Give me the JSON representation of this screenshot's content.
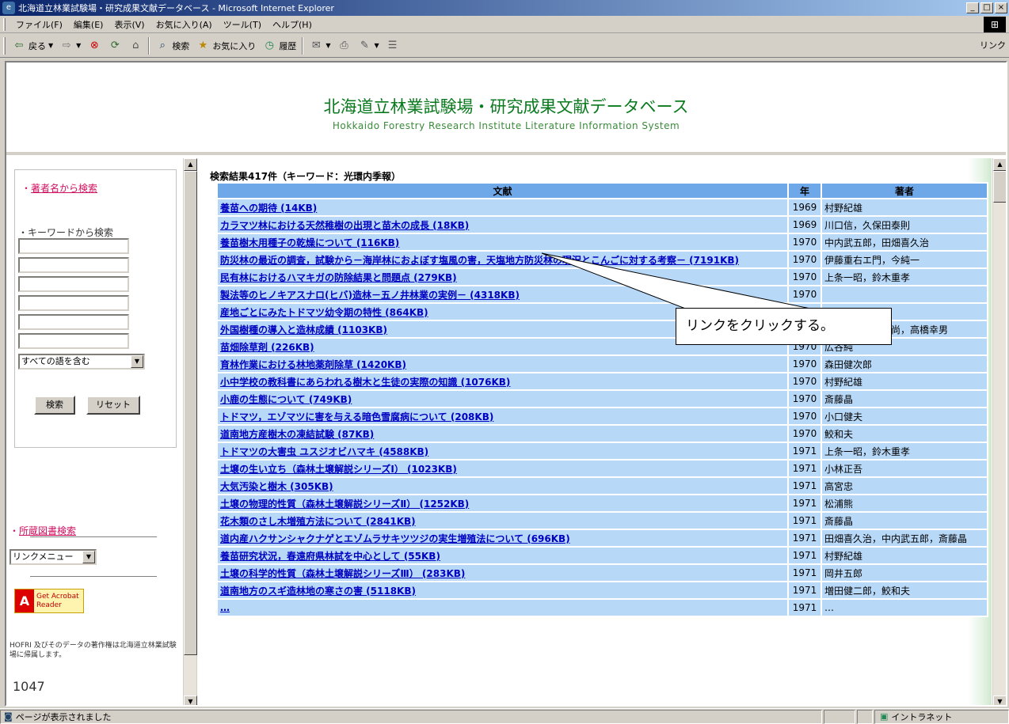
{
  "window": {
    "title": "北海道立林業試験場・研究成果文献データベース - Microsoft Internet Explorer",
    "buttons": [
      "_",
      "□",
      "×"
    ]
  },
  "menubar": {
    "items": [
      "ファイル(F)",
      "編集(E)",
      "表示(V)",
      "お気に入り(A)",
      "ツール(T)",
      "ヘルプ(H)"
    ]
  },
  "toolbar": {
    "back": "戻る",
    "search": "検索",
    "favorites": "お気に入り",
    "history": "履歴",
    "links": "リンク"
  },
  "header": {
    "title_jp": "北海道立林業試験場・研究成果文献データベース",
    "title_en": "Hokkaido Forestry Research Institute Literature Information System"
  },
  "sidebar": {
    "author_search": "著者名から検索",
    "keyword_label": "キーワードから検索",
    "match_mode": "すべての語を含む",
    "search_button": "検索",
    "reset_button": "リセット",
    "library_search": "所蔵図書検索",
    "link_menu": "リンクメニュー",
    "acrobat_line1": "Get Acrobat",
    "acrobat_line2": "Reader",
    "acrobat_logo": "A",
    "copyright": "HOFRI 及びそのデータの著作権は北海道立林業試験場に帰属します。",
    "counter": "1047"
  },
  "results": {
    "summary": "検索結果417件（キーワード：光環内季報）",
    "columns": [
      "文献",
      "年",
      "著者"
    ],
    "rows": [
      {
        "title": "養苗への期待 (14KB)",
        "year": "1969",
        "author": "村野紀雄"
      },
      {
        "title": "カラマツ林における天然稚樹の出現と苗木の成長 (18KB)",
        "year": "1969",
        "author": "川口信，久保田泰則"
      },
      {
        "title": "養苗樹木用種子の乾燥について (116KB)",
        "year": "1970",
        "author": "中内武五郎，田畑喜久治"
      },
      {
        "title": "防災林の最近の調査，試験から－海岸林におよぼす塩風の害，天塩地方防災林の現況とこんごに対する考察－ (7191KB)",
        "year": "1970",
        "author": "伊藤重右エ門，今純一"
      },
      {
        "title": "民有林におけるハマキガの防除結果と問題点 (279KB)",
        "year": "1970",
        "author": "上条一昭，鈴木重孝"
      },
      {
        "title": "製法等のヒノキアスナロ(ヒバ)造林－五ノ井林業の実例－ (4318KB)",
        "year": "1970",
        "author": ""
      },
      {
        "title": "産地ごとにみたトドマツ幼令期の特性 (864KB)",
        "year": "1970",
        "author": ""
      },
      {
        "title": "外国樹種の導入と造林成績 (1103KB)",
        "year": "1970",
        "author": "…弁重雄，花房尚，高橋幸男"
      },
      {
        "title": "苗畑除草剤 (226KB)",
        "year": "1970",
        "author": "広谷純"
      },
      {
        "title": "育林作業における林地薬剤除草 (1420KB)",
        "year": "1970",
        "author": "森田健次郎"
      },
      {
        "title": "小中学校の教科書にあらわれる樹木と生徒の実際の知識 (1076KB)",
        "year": "1970",
        "author": "村野紀雄"
      },
      {
        "title": "小鹿の生態について (749KB)",
        "year": "1970",
        "author": "斎藤晶"
      },
      {
        "title": "トドマツ，エゾマツに害を与える暗色雪腐病について (208KB)",
        "year": "1970",
        "author": "小口健夫"
      },
      {
        "title": "道南地方産樹木の凍結試験 (87KB)",
        "year": "1970",
        "author": "鮫和夫"
      },
      {
        "title": "トドマツの大害虫 ユスジオビハマキ (4588KB)",
        "year": "1971",
        "author": "上条一昭，鈴木重孝"
      },
      {
        "title": "土壌の生い立ち（森林土壌解説シリーズⅠ） (1023KB)",
        "year": "1971",
        "author": "小林正吾"
      },
      {
        "title": "大気汚染と樹木 (305KB)",
        "year": "1971",
        "author": "高宮忠"
      },
      {
        "title": "土壌の物理的性質（森林土壌解説シリーズⅡ） (1252KB)",
        "year": "1971",
        "author": "松浦熊"
      },
      {
        "title": "花木類のさし木増殖方法について (2841KB)",
        "year": "1971",
        "author": "斎藤晶"
      },
      {
        "title": "道内産ハクサンシャクナゲとエゾムラサキツツジの実生増殖法について (696KB)",
        "year": "1971",
        "author": "田畑喜久治，中内武五郎，斎藤晶"
      },
      {
        "title": "養苗研究状況，春遠府県林試を中心として (55KB)",
        "year": "1971",
        "author": "村野紀雄"
      },
      {
        "title": "土壌の科学的性質（森林土壌解説シリーズⅢ） (283KB)",
        "year": "1971",
        "author": "岡井五郎"
      },
      {
        "title": "道南地方のスギ造林地の寒さの害 (5118KB)",
        "year": "1971",
        "author": "増田健二郎，鮫和夫"
      },
      {
        "title": "…",
        "year": "1971",
        "author": "…"
      }
    ]
  },
  "callout": {
    "text": "リンクをクリックする。"
  },
  "statusbar": {
    "text": "ページが表示されました",
    "zone": "イントラネット"
  }
}
